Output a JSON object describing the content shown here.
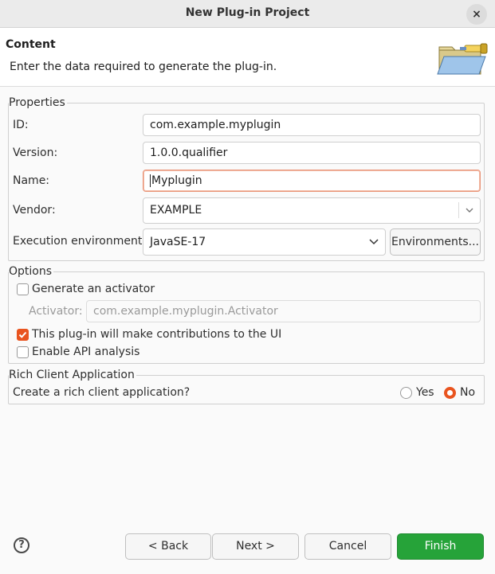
{
  "window": {
    "title": "New Plug-in Project",
    "close_glyph": "×"
  },
  "header": {
    "title": "Content",
    "description": "Enter the data required to generate the plug-in."
  },
  "properties": {
    "legend": "Properties",
    "id_label": "ID:",
    "id_value": "com.example.myplugin",
    "version_label": "Version:",
    "version_value": "1.0.0.qualifier",
    "name_label": "Name:",
    "name_value": "Myplugin",
    "vendor_label": "Vendor:",
    "vendor_value": "EXAMPLE",
    "env_label": "Execution environment:",
    "env_value": "JavaSE-17",
    "environments_button": "Environments..."
  },
  "options": {
    "legend": "Options",
    "generate_activator": "Generate an activator",
    "generate_activator_checked": false,
    "activator_label": "Activator:",
    "activator_value": "com.example.myplugin.Activator",
    "ui_contributions": "This plug-in will make contributions to the UI",
    "ui_contributions_checked": true,
    "api_analysis": "Enable API analysis",
    "api_analysis_checked": false
  },
  "rca": {
    "legend": "Rich Client Application",
    "question": "Create a rich client application?",
    "yes": "Yes",
    "no": "No",
    "selected": "No"
  },
  "footer": {
    "help_glyph": "?",
    "back": "< Back",
    "next": "Next >",
    "cancel": "Cancel",
    "finish": "Finish"
  },
  "colors": {
    "accent": "#e9541f",
    "finish": "#26a339",
    "focus_border": "#e9967a"
  },
  "icons": [
    "close-icon",
    "folder-banner-icon",
    "chevron-down-icon",
    "help-icon",
    "checkmark-icon"
  ]
}
